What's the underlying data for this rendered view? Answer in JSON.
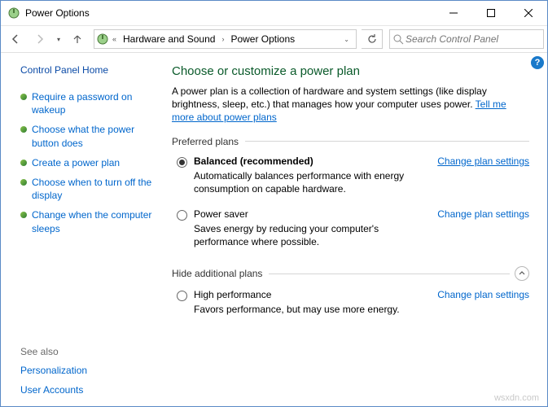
{
  "title": "Power Options",
  "breadcrumb": {
    "item1": "Hardware and Sound",
    "item2": "Power Options"
  },
  "search": {
    "placeholder": "Search Control Panel"
  },
  "sidebar": {
    "home": "Control Panel Home",
    "links": [
      "Require a password on wakeup",
      "Choose what the power button does",
      "Create a power plan",
      "Choose when to turn off the display",
      "Change when the computer sleeps"
    ],
    "see_also_label": "See also",
    "see_also": [
      "Personalization",
      "User Accounts"
    ]
  },
  "main": {
    "heading": "Choose or customize a power plan",
    "desc_pre": "A power plan is a collection of hardware and system settings (like display brightness, sleep, etc.) that manages how your computer uses power. ",
    "desc_link": "Tell me more about power plans",
    "preferred_label": "Preferred plans",
    "hide_label": "Hide additional plans",
    "plans": {
      "balanced": {
        "name": "Balanced (recommended)",
        "desc": "Automatically balances performance with energy consumption on capable hardware.",
        "link": "Change plan settings"
      },
      "saver": {
        "name": "Power saver",
        "desc": "Saves energy by reducing your computer's performance where possible.",
        "link": "Change plan settings"
      },
      "high": {
        "name": "High performance",
        "desc": "Favors performance, but may use more energy.",
        "link": "Change plan settings"
      }
    }
  },
  "watermark": "wsxdn.com"
}
